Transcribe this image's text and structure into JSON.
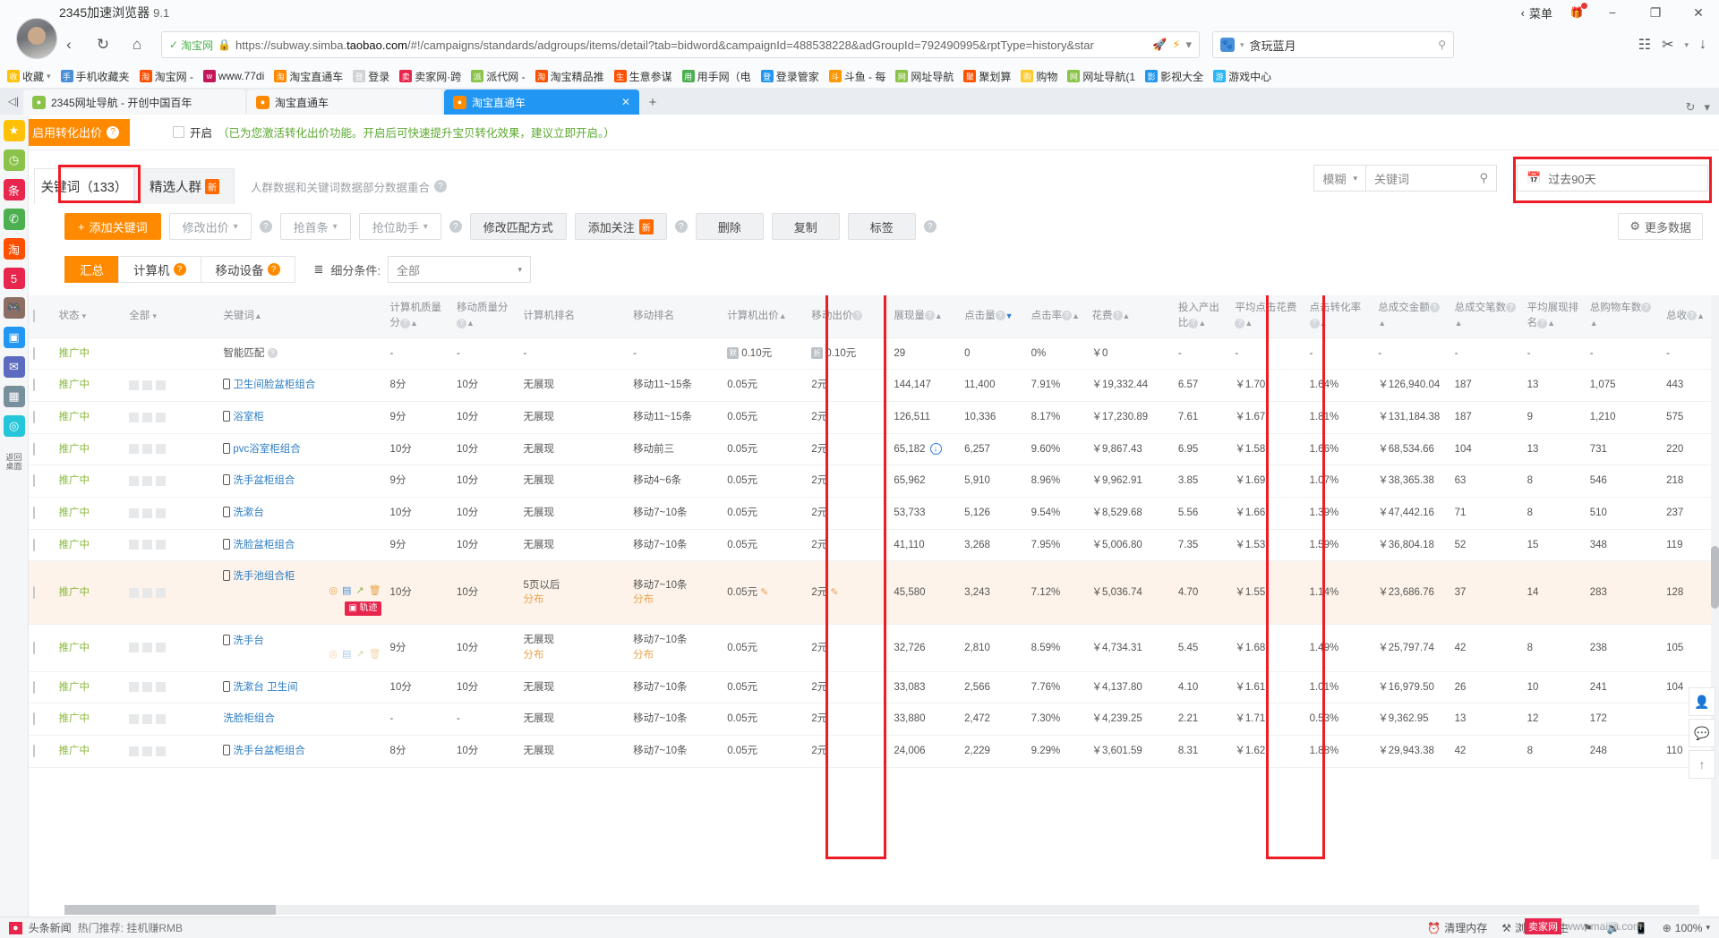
{
  "browser": {
    "app_name": "2345加速浏览器",
    "app_version": "9.1",
    "menu_label": "菜单",
    "ssl_site": "淘宝网",
    "url_prefix": "https://subway.simba.",
    "url_host": "taobao.com",
    "url_path": "/#!/campaigns/standards/adgroups/items/detail?tab=bidword&campaignId=488538228&adGroupId=792490995&rptType=history&star",
    "search_value": "贪玩蓝月",
    "bookmarks": [
      {
        "label": "收藏",
        "icon": "star-icon",
        "color": "#ffc107"
      },
      {
        "label": "手机收藏夹",
        "icon": "phone-icon",
        "color": "#4a90d9"
      },
      {
        "label": "淘宝网 -",
        "icon": "taobao-icon",
        "color": "#ff5000"
      },
      {
        "label": "www.77di",
        "icon": "site-icon",
        "color": "#c2185b"
      },
      {
        "label": "淘宝直通车",
        "icon": "rocket-icon",
        "color": "#ff8a00"
      },
      {
        "label": "登录",
        "icon": "page-icon",
        "color": "#cfd3d6"
      },
      {
        "label": "卖家网·跨",
        "icon": "sell-icon",
        "color": "#e8254c"
      },
      {
        "label": "派代网 -",
        "icon": "pai-icon",
        "color": "#8bc34a"
      },
      {
        "label": "淘宝精品推",
        "icon": "taobao-icon",
        "color": "#ff5000"
      },
      {
        "label": "生意参谋",
        "icon": "taobao-icon",
        "color": "#ff5000"
      },
      {
        "label": "用手网（电",
        "icon": "bag-icon",
        "color": "#4caf50"
      },
      {
        "label": "登录管家",
        "icon": "login-icon",
        "color": "#2196f3"
      },
      {
        "label": "斗鱼 - 每",
        "icon": "fish-icon",
        "color": "#ff9800"
      },
      {
        "label": "网址导航",
        "icon": "nav2345-icon",
        "color": "#8bc34a"
      },
      {
        "label": "聚划算",
        "icon": "taobao-icon",
        "color": "#ff5000"
      },
      {
        "label": "购物",
        "icon": "folder-icon",
        "color": "#ffca28"
      },
      {
        "label": "网址导航(1",
        "icon": "nav2345-icon",
        "color": "#8bc34a"
      },
      {
        "label": "影视大全",
        "icon": "film-icon",
        "color": "#2196f3"
      },
      {
        "label": "游戏中心",
        "icon": "game-icon",
        "color": "#29b6f6"
      }
    ],
    "tabs": [
      {
        "label": "2345网址导航 - 开创中国百年",
        "icon": "nav2345-icon",
        "color": "#8bc34a",
        "active": false
      },
      {
        "label": "淘宝直通车",
        "icon": "rocket-icon",
        "color": "#ff8a00",
        "active": false
      },
      {
        "label": "淘宝直通车",
        "icon": "rocket-icon",
        "color": "#ff8a00",
        "active": true
      }
    ]
  },
  "leftrail": [
    {
      "name": "star-icon",
      "glyph": "★",
      "color": "#ffc107"
    },
    {
      "name": "clock-icon",
      "glyph": "◷",
      "color": "#8bc34a"
    },
    {
      "name": "headline-icon",
      "glyph": "条",
      "color": "#e8254c"
    },
    {
      "name": "wechat-icon",
      "glyph": "✆",
      "color": "#4caf50"
    },
    {
      "name": "taobao-icon",
      "glyph": "淘",
      "color": "#ff5000"
    },
    {
      "name": "number-icon",
      "glyph": "5",
      "color": "#e8254c"
    },
    {
      "name": "game-icon",
      "glyph": "🎮",
      "color": "#8d6e63"
    },
    {
      "name": "video-icon",
      "glyph": "▣",
      "color": "#2196f3"
    },
    {
      "name": "mail-icon",
      "glyph": "✉",
      "color": "#5c6bc0"
    },
    {
      "name": "calc-icon",
      "glyph": "▦",
      "color": "#78909c"
    },
    {
      "name": "compass-icon",
      "glyph": "◎",
      "color": "#26c6da"
    }
  ],
  "leftrail_bottom_label": "返回\n桌面",
  "banner": {
    "tag": "启用转化出价",
    "checkbox_label": "开启",
    "note": "（已为您激活转化出价功能。开启后可快速提升宝贝转化效果，建议立即开启。）"
  },
  "kwtabs": {
    "keyword_tab": "关键词（133）",
    "crowd_tab": "精选人群",
    "crowd_badge": "新",
    "note": "人群数据和关键词数据部分数据重合"
  },
  "actions": {
    "add_keyword": "添加关键词",
    "modify_bid": "修改出价",
    "grab_top": "抢首条",
    "position_helper": "抢位助手",
    "modify_match": "修改匹配方式",
    "add_follow": "添加关注",
    "add_follow_badge": "新",
    "delete": "删除",
    "copy": "复制",
    "tag": "标签",
    "more_data": "更多数据"
  },
  "filters": {
    "match_mode": "模糊",
    "search_placeholder": "关键词",
    "date_range": "过去90天"
  },
  "segments": {
    "summary": "汇总",
    "computer": "计算机",
    "mobile": "移动设备",
    "subcondition_label": "细分条件:",
    "subcondition_value": "全部"
  },
  "table": {
    "headers": {
      "status": "状态",
      "all": "全部",
      "keyword": "关键词",
      "pc_quality": "计算机质量分",
      "mobile_quality": "移动质量分",
      "pc_rank": "计算机排名",
      "mobile_rank": "移动排名",
      "pc_bid": "计算机出价",
      "mobile_bid": "移动出价",
      "impressions": "展现量",
      "clicks": "点击量",
      "ctr": "点击率",
      "spend": "花费",
      "roi": "投入产出比",
      "avg_cpc": "平均点击花费",
      "click_conv": "点击转化率",
      "total_gmv": "总成交金额",
      "total_orders": "总成交笔数",
      "avg_impr_rank": "平均展现排名",
      "total_cart": "总购物车数",
      "total_fav": "总收"
    },
    "rows": [
      {
        "status": "推广中",
        "keyword": "智能匹配",
        "keyword_type": "plain",
        "has_phone": false,
        "pc_quality": "-",
        "mobile_quality": "-",
        "pc_rank": "-",
        "mobile_rank": "-",
        "pc_bid": "0.10元",
        "pc_bid_badge": "默",
        "mobile_bid": "0.10元",
        "mobile_bid_badge": "折",
        "impressions": "29",
        "clicks": "0",
        "ctr": "0%",
        "spend": "￥0",
        "roi": "-",
        "avg_cpc": "-",
        "click_conv": "-",
        "total_gmv": "-",
        "total_orders": "-",
        "avg_impr_rank": "-",
        "total_cart": "-",
        "total_fav": "-",
        "highlight": false
      },
      {
        "status": "推广中",
        "keyword": "卫生间脸盆柜组合",
        "keyword_type": "link",
        "has_phone": true,
        "pc_quality": "8分",
        "mobile_quality": "10分",
        "pc_rank": "无展现",
        "mobile_rank": "移动11~15条",
        "pc_bid": "0.05元",
        "mobile_bid": "2元",
        "impressions": "144,147",
        "clicks": "11,400",
        "ctr": "7.91%",
        "spend": "￥19,332.44",
        "roi": "6.57",
        "avg_cpc": "￥1.70",
        "click_conv": "1.64%",
        "total_gmv": "￥126,940.04",
        "total_orders": "187",
        "avg_impr_rank": "13",
        "total_cart": "1,075",
        "total_fav": "443",
        "highlight": false
      },
      {
        "status": "推广中",
        "keyword": "浴室柜",
        "keyword_type": "link",
        "has_phone": true,
        "pc_quality": "9分",
        "mobile_quality": "10分",
        "pc_rank": "无展现",
        "mobile_rank": "移动11~15条",
        "pc_bid": "0.05元",
        "mobile_bid": "2元",
        "impressions": "126,511",
        "clicks": "10,336",
        "ctr": "8.17%",
        "spend": "￥17,230.89",
        "roi": "7.61",
        "avg_cpc": "￥1.67",
        "click_conv": "1.81%",
        "total_gmv": "￥131,184.38",
        "total_orders": "187",
        "avg_impr_rank": "9",
        "total_cart": "1,210",
        "total_fav": "575",
        "highlight": false
      },
      {
        "status": "推广中",
        "keyword": "pvc浴室柜组合",
        "keyword_type": "link",
        "has_phone": true,
        "pc_quality": "10分",
        "mobile_quality": "10分",
        "pc_rank": "无展现",
        "mobile_rank": "移动前三",
        "pc_bid": "0.05元",
        "mobile_bid": "2元",
        "impressions": "65,182",
        "impressions_info": true,
        "clicks": "6,257",
        "ctr": "9.60%",
        "spend": "￥9,867.43",
        "roi": "6.95",
        "avg_cpc": "￥1.58",
        "click_conv": "1.66%",
        "total_gmv": "￥68,534.66",
        "total_orders": "104",
        "avg_impr_rank": "13",
        "total_cart": "731",
        "total_fav": "220",
        "highlight": false
      },
      {
        "status": "推广中",
        "keyword": "洗手盆柜组合",
        "keyword_type": "link",
        "has_phone": true,
        "pc_quality": "9分",
        "mobile_quality": "10分",
        "pc_rank": "无展现",
        "mobile_rank": "移动4~6条",
        "pc_bid": "0.05元",
        "mobile_bid": "2元",
        "impressions": "65,962",
        "clicks": "5,910",
        "ctr": "8.96%",
        "spend": "￥9,962.91",
        "roi": "3.85",
        "avg_cpc": "￥1.69",
        "click_conv": "1.07%",
        "total_gmv": "￥38,365.38",
        "total_orders": "63",
        "avg_impr_rank": "8",
        "total_cart": "546",
        "total_fav": "218",
        "highlight": false
      },
      {
        "status": "推广中",
        "keyword": "洗漱台",
        "keyword_type": "link",
        "has_phone": true,
        "pc_quality": "10分",
        "mobile_quality": "10分",
        "pc_rank": "无展现",
        "mobile_rank": "移动7~10条",
        "pc_bid": "0.05元",
        "mobile_bid": "2元",
        "impressions": "53,733",
        "clicks": "5,126",
        "ctr": "9.54%",
        "spend": "￥8,529.68",
        "roi": "5.56",
        "avg_cpc": "￥1.66",
        "click_conv": "1.39%",
        "total_gmv": "￥47,442.16",
        "total_orders": "71",
        "avg_impr_rank": "8",
        "total_cart": "510",
        "total_fav": "237",
        "highlight": false
      },
      {
        "status": "推广中",
        "keyword": "洗脸盆柜组合",
        "keyword_type": "link",
        "has_phone": true,
        "pc_quality": "9分",
        "mobile_quality": "10分",
        "pc_rank": "无展现",
        "mobile_rank": "移动7~10条",
        "pc_bid": "0.05元",
        "mobile_bid": "2元",
        "impressions": "41,110",
        "clicks": "3,268",
        "ctr": "7.95%",
        "spend": "￥5,006.80",
        "roi": "7.35",
        "avg_cpc": "￥1.53",
        "click_conv": "1.59%",
        "total_gmv": "￥36,804.18",
        "total_orders": "52",
        "avg_impr_rank": "15",
        "total_cart": "348",
        "total_fav": "119",
        "highlight": false
      },
      {
        "status": "推广中",
        "keyword": "洗手池组合柜",
        "keyword_type": "link",
        "has_phone": true,
        "row_icons": true,
        "track_badge": "轨迹",
        "pc_quality": "10分",
        "mobile_quality": "10分",
        "pc_rank": "5页以后",
        "pc_rank_sub": "分布",
        "mobile_rank": "移动7~10条",
        "mobile_rank_sub": "分布",
        "pc_bid": "0.05元",
        "mobile_bid": "2元",
        "impressions": "45,580",
        "clicks": "3,243",
        "ctr": "7.12%",
        "spend": "￥5,036.74",
        "roi": "4.70",
        "avg_cpc": "￥1.55",
        "click_conv": "1.14%",
        "total_gmv": "￥23,686.76",
        "total_orders": "37",
        "avg_impr_rank": "14",
        "total_cart": "283",
        "total_fav": "128",
        "highlight": true
      },
      {
        "status": "推广中",
        "keyword": "洗手台",
        "keyword_type": "link",
        "has_phone": true,
        "row_icons": true,
        "row_icons_dim": true,
        "pc_quality": "9分",
        "mobile_quality": "10分",
        "pc_rank": "无展现",
        "pc_rank_sub": "分布",
        "mobile_rank": "移动7~10条",
        "mobile_rank_sub": "分布",
        "pc_bid": "0.05元",
        "mobile_bid": "2元",
        "impressions": "32,726",
        "clicks": "2,810",
        "ctr": "8.59%",
        "spend": "￥4,734.31",
        "roi": "5.45",
        "avg_cpc": "￥1.68",
        "click_conv": "1.49%",
        "total_gmv": "￥25,797.74",
        "total_orders": "42",
        "avg_impr_rank": "8",
        "total_cart": "238",
        "total_fav": "105",
        "highlight": false
      },
      {
        "status": "推广中",
        "keyword": "洗漱台 卫生间",
        "keyword_type": "link",
        "has_phone": true,
        "pc_quality": "10分",
        "mobile_quality": "10分",
        "pc_rank": "无展现",
        "mobile_rank": "移动7~10条",
        "pc_bid": "0.05元",
        "mobile_bid": "2元",
        "impressions": "33,083",
        "clicks": "2,566",
        "ctr": "7.76%",
        "spend": "￥4,137.80",
        "roi": "4.10",
        "avg_cpc": "￥1.61",
        "click_conv": "1.01%",
        "total_gmv": "￥16,979.50",
        "total_orders": "26",
        "avg_impr_rank": "10",
        "total_cart": "241",
        "total_fav": "104",
        "highlight": false
      },
      {
        "status": "推广中",
        "keyword": "洗脸柜组合",
        "keyword_type": "link",
        "has_phone": false,
        "pc_quality": "-",
        "mobile_quality": "-",
        "pc_rank": "无展现",
        "mobile_rank": "移动7~10条",
        "pc_bid": "0.05元",
        "mobile_bid": "2元",
        "impressions": "33,880",
        "clicks": "2,472",
        "ctr": "7.30%",
        "spend": "￥4,239.25",
        "roi": "2.21",
        "avg_cpc": "￥1.71",
        "click_conv": "0.53%",
        "total_gmv": "￥9,362.95",
        "total_orders": "13",
        "avg_impr_rank": "12",
        "total_cart": "172",
        "total_fav": "",
        "highlight": false
      },
      {
        "status": "推广中",
        "keyword": "洗手台盆柜组合",
        "keyword_type": "link",
        "has_phone": true,
        "pc_quality": "8分",
        "mobile_quality": "10分",
        "pc_rank": "无展现",
        "mobile_rank": "移动7~10条",
        "pc_bid": "0.05元",
        "mobile_bid": "2元",
        "impressions": "24,006",
        "clicks": "2,229",
        "ctr": "9.29%",
        "spend": "￥3,601.59",
        "roi": "8.31",
        "avg_cpc": "￥1.62",
        "click_conv": "1.88%",
        "total_gmv": "￥29,943.38",
        "total_orders": "42",
        "avg_impr_rank": "8",
        "total_cart": "248",
        "total_fav": "110",
        "highlight": false
      }
    ]
  },
  "statusbar": {
    "news_label": "头条新闻",
    "hot_label": "热门推荐: 挂机赚RMB",
    "clear_memory": "清理内存",
    "browser_doctor": "浏览器医生",
    "zoom": "100%",
    "watermark_tag": "卖家网",
    "watermark_url": "www.maijia.com"
  },
  "colors": {
    "accent_orange": "#ff8a00",
    "link_blue": "#2e7ec4",
    "status_green": "#8cb83f",
    "highlight_red": "#ee1c25",
    "row_highlight": "#fdf3ea"
  }
}
